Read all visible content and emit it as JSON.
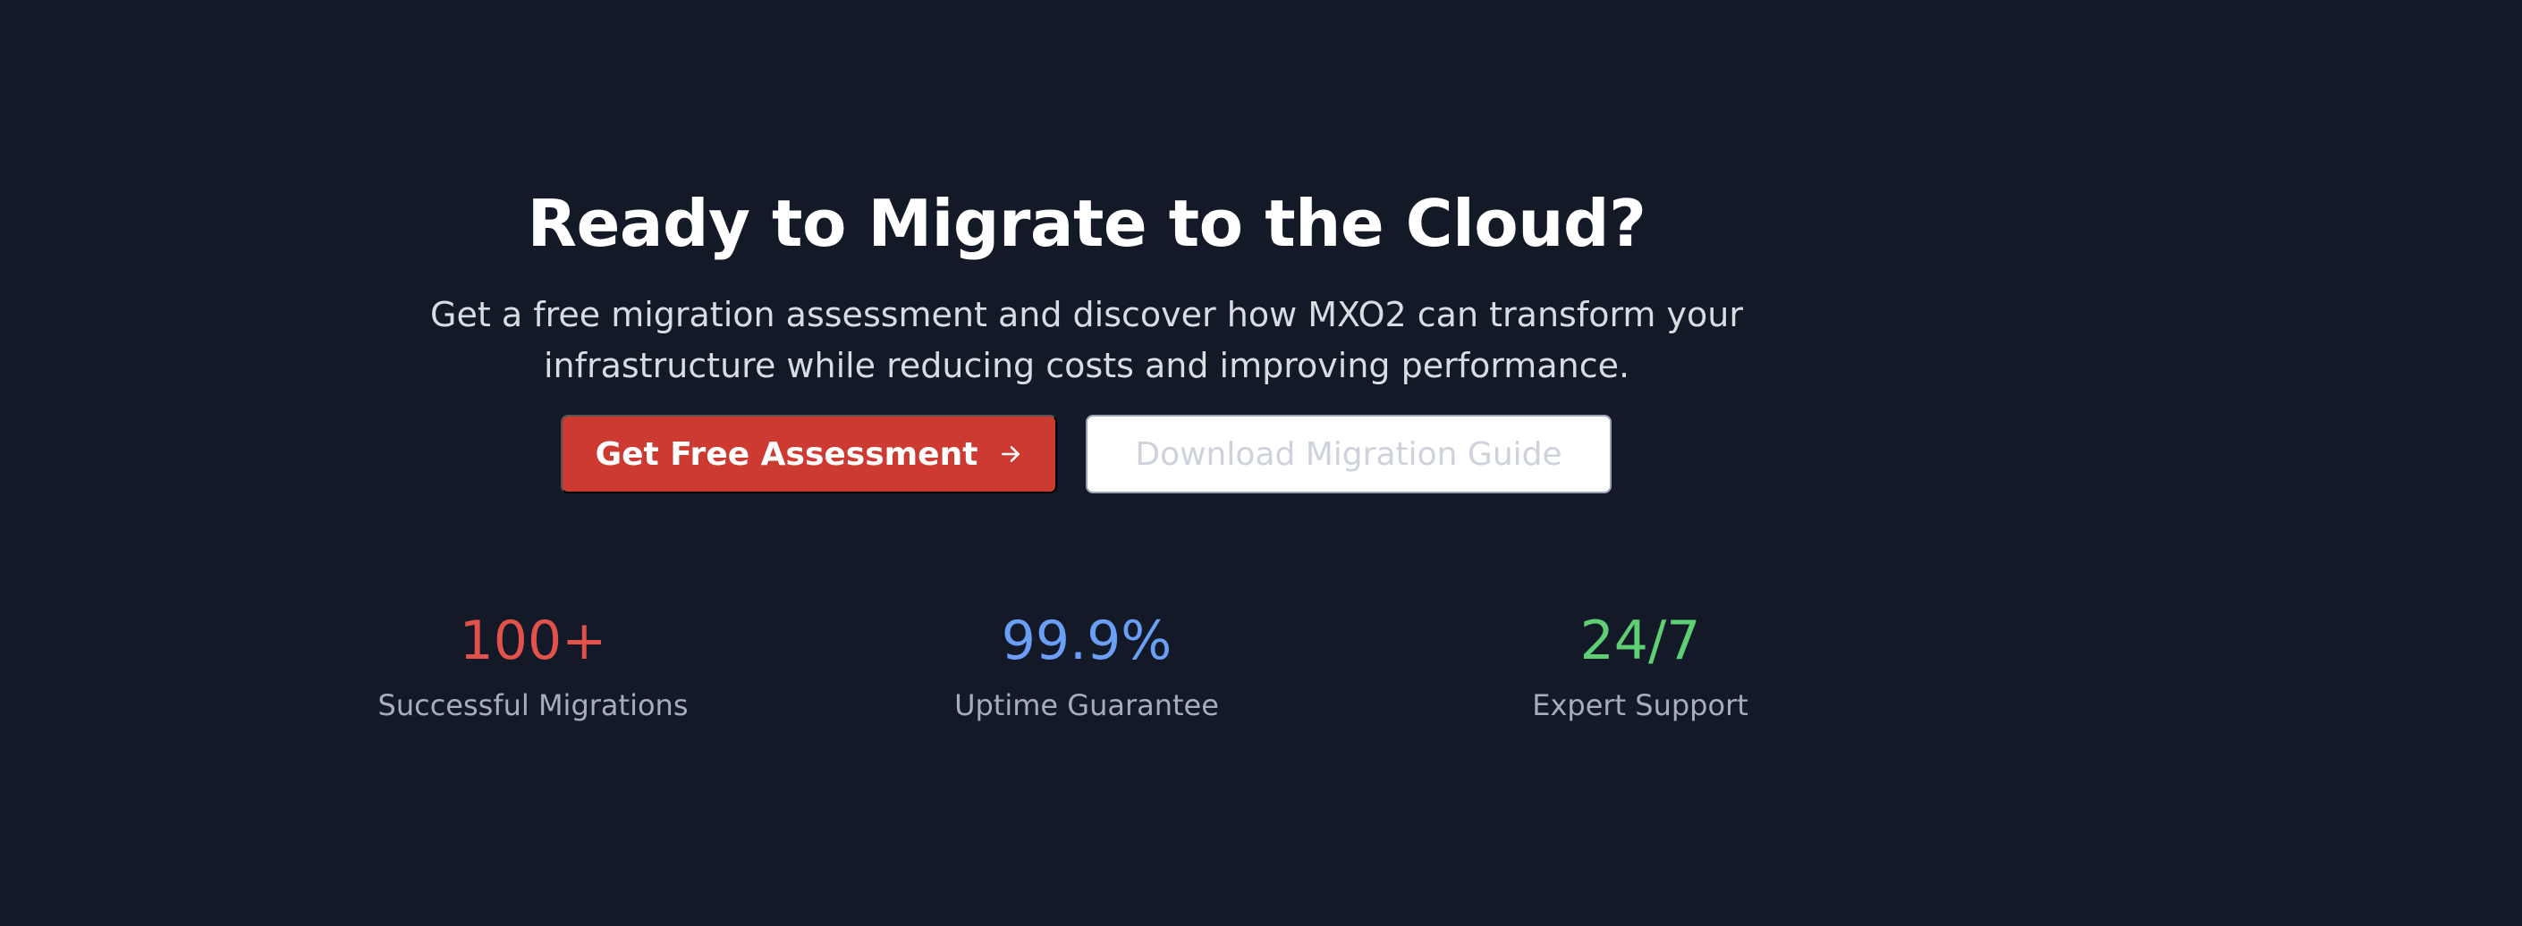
{
  "cta": {
    "headline": "Ready to Migrate to the Cloud?",
    "subtitle": "Get a free migration assessment and discover how MXO2 can transform your infrastructure while reducing costs and improving performance.",
    "primary_button": {
      "label": "Get Free Assessment",
      "icon": "arrow-right-icon",
      "color": "#cc3a31"
    },
    "secondary_button": {
      "label": "Download Migration Guide"
    }
  },
  "stats": [
    {
      "value": "100+",
      "label": "Successful Migrations",
      "color": "#e0524a"
    },
    {
      "value": "99.9%",
      "label": "Uptime Guarantee",
      "color": "#6b9ef5"
    },
    {
      "value": "24/7",
      "label": "Expert Support",
      "color": "#5fcf74"
    }
  ],
  "colors": {
    "background": "#131927"
  }
}
